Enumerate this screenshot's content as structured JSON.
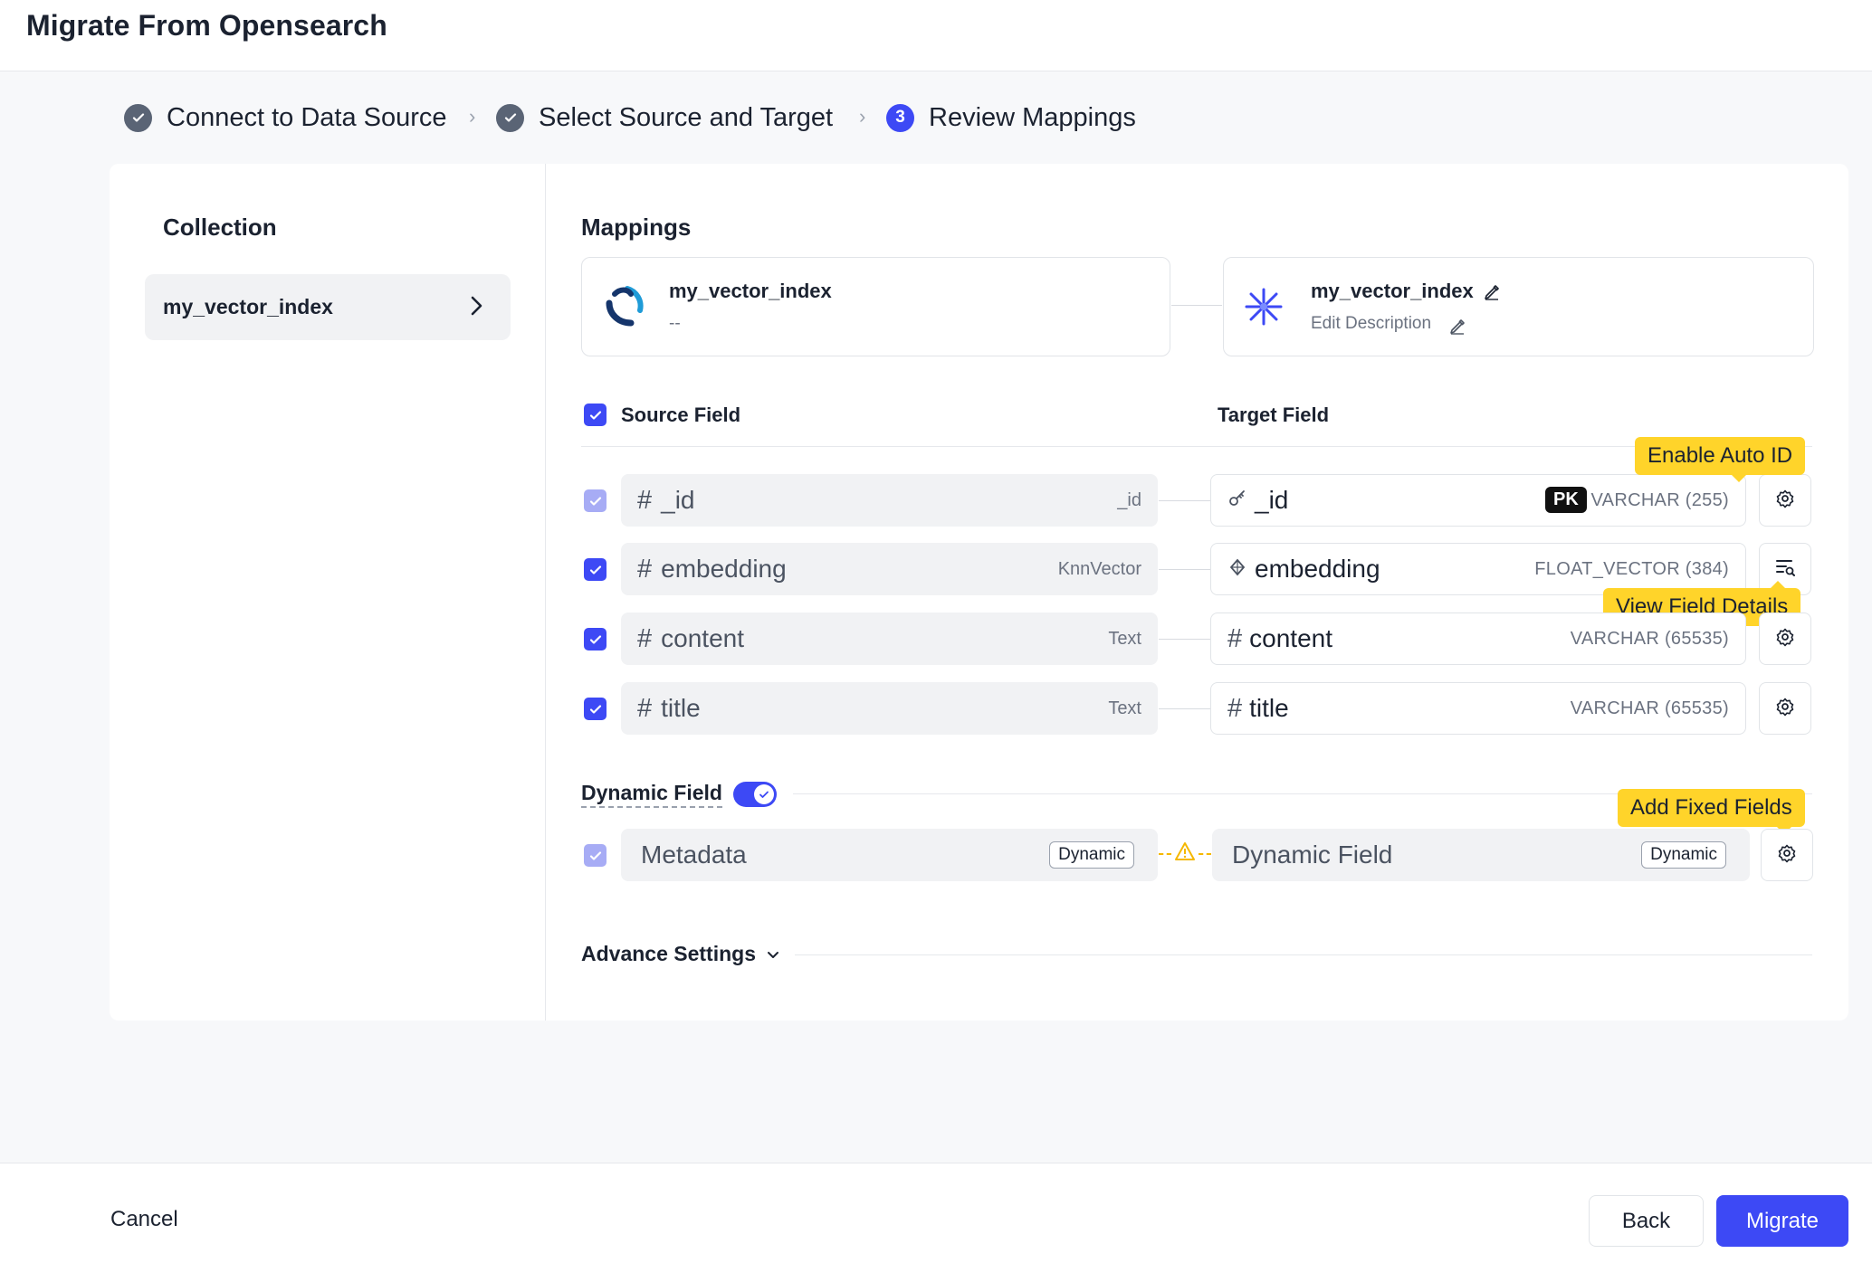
{
  "header": {
    "title": "Migrate From Opensearch"
  },
  "stepper": {
    "steps": [
      {
        "label": "Connect to Data Source",
        "status": "done",
        "icon": "check-icon"
      },
      {
        "label": "Select Source and Target",
        "status": "done",
        "icon": "check-icon"
      },
      {
        "label": "Review Mappings",
        "status": "active",
        "number": "3"
      }
    ]
  },
  "collection": {
    "title": "Collection",
    "items": [
      {
        "label": "my_vector_index"
      }
    ]
  },
  "mappings": {
    "title": "Mappings",
    "source_index": {
      "name": "my_vector_index",
      "description": "--",
      "icon": "opensearch-logo-icon"
    },
    "target_index": {
      "name": "my_vector_index",
      "description": "Edit Description",
      "icon": "milvus-logo-icon"
    },
    "source_header": "Source Field",
    "target_header": "Target Field",
    "rows": [
      {
        "source_name": "_id",
        "source_type": "_id",
        "target_name": "_id",
        "target_type": "VARCHAR (255)",
        "badge": "PK",
        "action_icon": "gear-icon"
      },
      {
        "source_name": "embedding",
        "source_type": "KnnVector",
        "target_name": "embedding",
        "target_type": "FLOAT_VECTOR (384)",
        "action_icon": "field-details-icon"
      },
      {
        "source_name": "content",
        "source_type": "Text",
        "target_name": "content",
        "target_type": "VARCHAR (65535)",
        "action_icon": "gear-icon"
      },
      {
        "source_name": "title",
        "source_type": "Text",
        "target_name": "title",
        "target_type": "VARCHAR (65535)",
        "action_icon": "gear-icon"
      }
    ],
    "tooltips": {
      "auto_id": "Enable Auto ID",
      "field_details": "View Field Details",
      "fixed_fields": "Add Fixed Fields"
    },
    "dynamic": {
      "label": "Dynamic Field",
      "enabled": true,
      "source_name": "Metadata",
      "source_badge": "Dynamic",
      "target_name": "Dynamic Field",
      "target_badge": "Dynamic"
    },
    "advance_settings": "Advance Settings"
  },
  "footer": {
    "cancel": "Cancel",
    "back": "Back",
    "migrate": "Migrate"
  },
  "colors": {
    "accent": "#3d49f5",
    "tooltip": "#ffd42a",
    "warning": "#f5b800"
  }
}
